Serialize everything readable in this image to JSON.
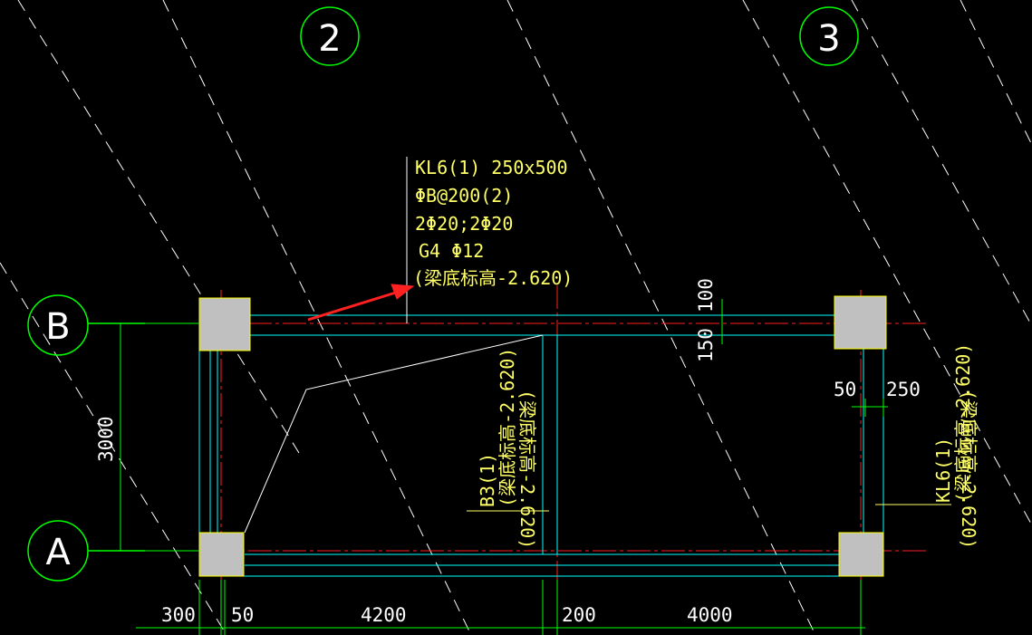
{
  "axes": {
    "vertical": [
      "2",
      "3"
    ],
    "horizontal": [
      "B",
      "A"
    ]
  },
  "beam_annotation": {
    "lines": [
      "KL6(1) 250x500",
      "ΦB@200(2)",
      "2Φ20;2Φ20",
      "G4 Φ12",
      "(梁底标高-2.620)"
    ]
  },
  "beam_b3": {
    "name": "B3(1)",
    "elevation": "(梁底标高-2.620)",
    "elevation_top": "(梁底标高-2.620)"
  },
  "beam_kl6_right": {
    "name": "KL6(1)",
    "elevation": "(梁底标高-2.620)",
    "elevation_top": "(梁底标高-2.620)"
  },
  "dimensions": {
    "left_height": "3000",
    "top_right_1": "100",
    "top_right_2": "150",
    "right_1": "50",
    "right_2": "250",
    "bottom": [
      "300",
      "50",
      "4200",
      "200",
      "4000"
    ]
  },
  "colors": {
    "background": "#000000",
    "axis_bubble": "#00ff00",
    "axis_line": "#ff0000",
    "beam_line": "#00ffff",
    "annotation": "#ffff66",
    "column_fill": "#c0c0c0",
    "column_border": "#ffff00",
    "dimension": "#00ff00",
    "hatch": "#ffffff",
    "leader_arrow": "#ff2020"
  }
}
